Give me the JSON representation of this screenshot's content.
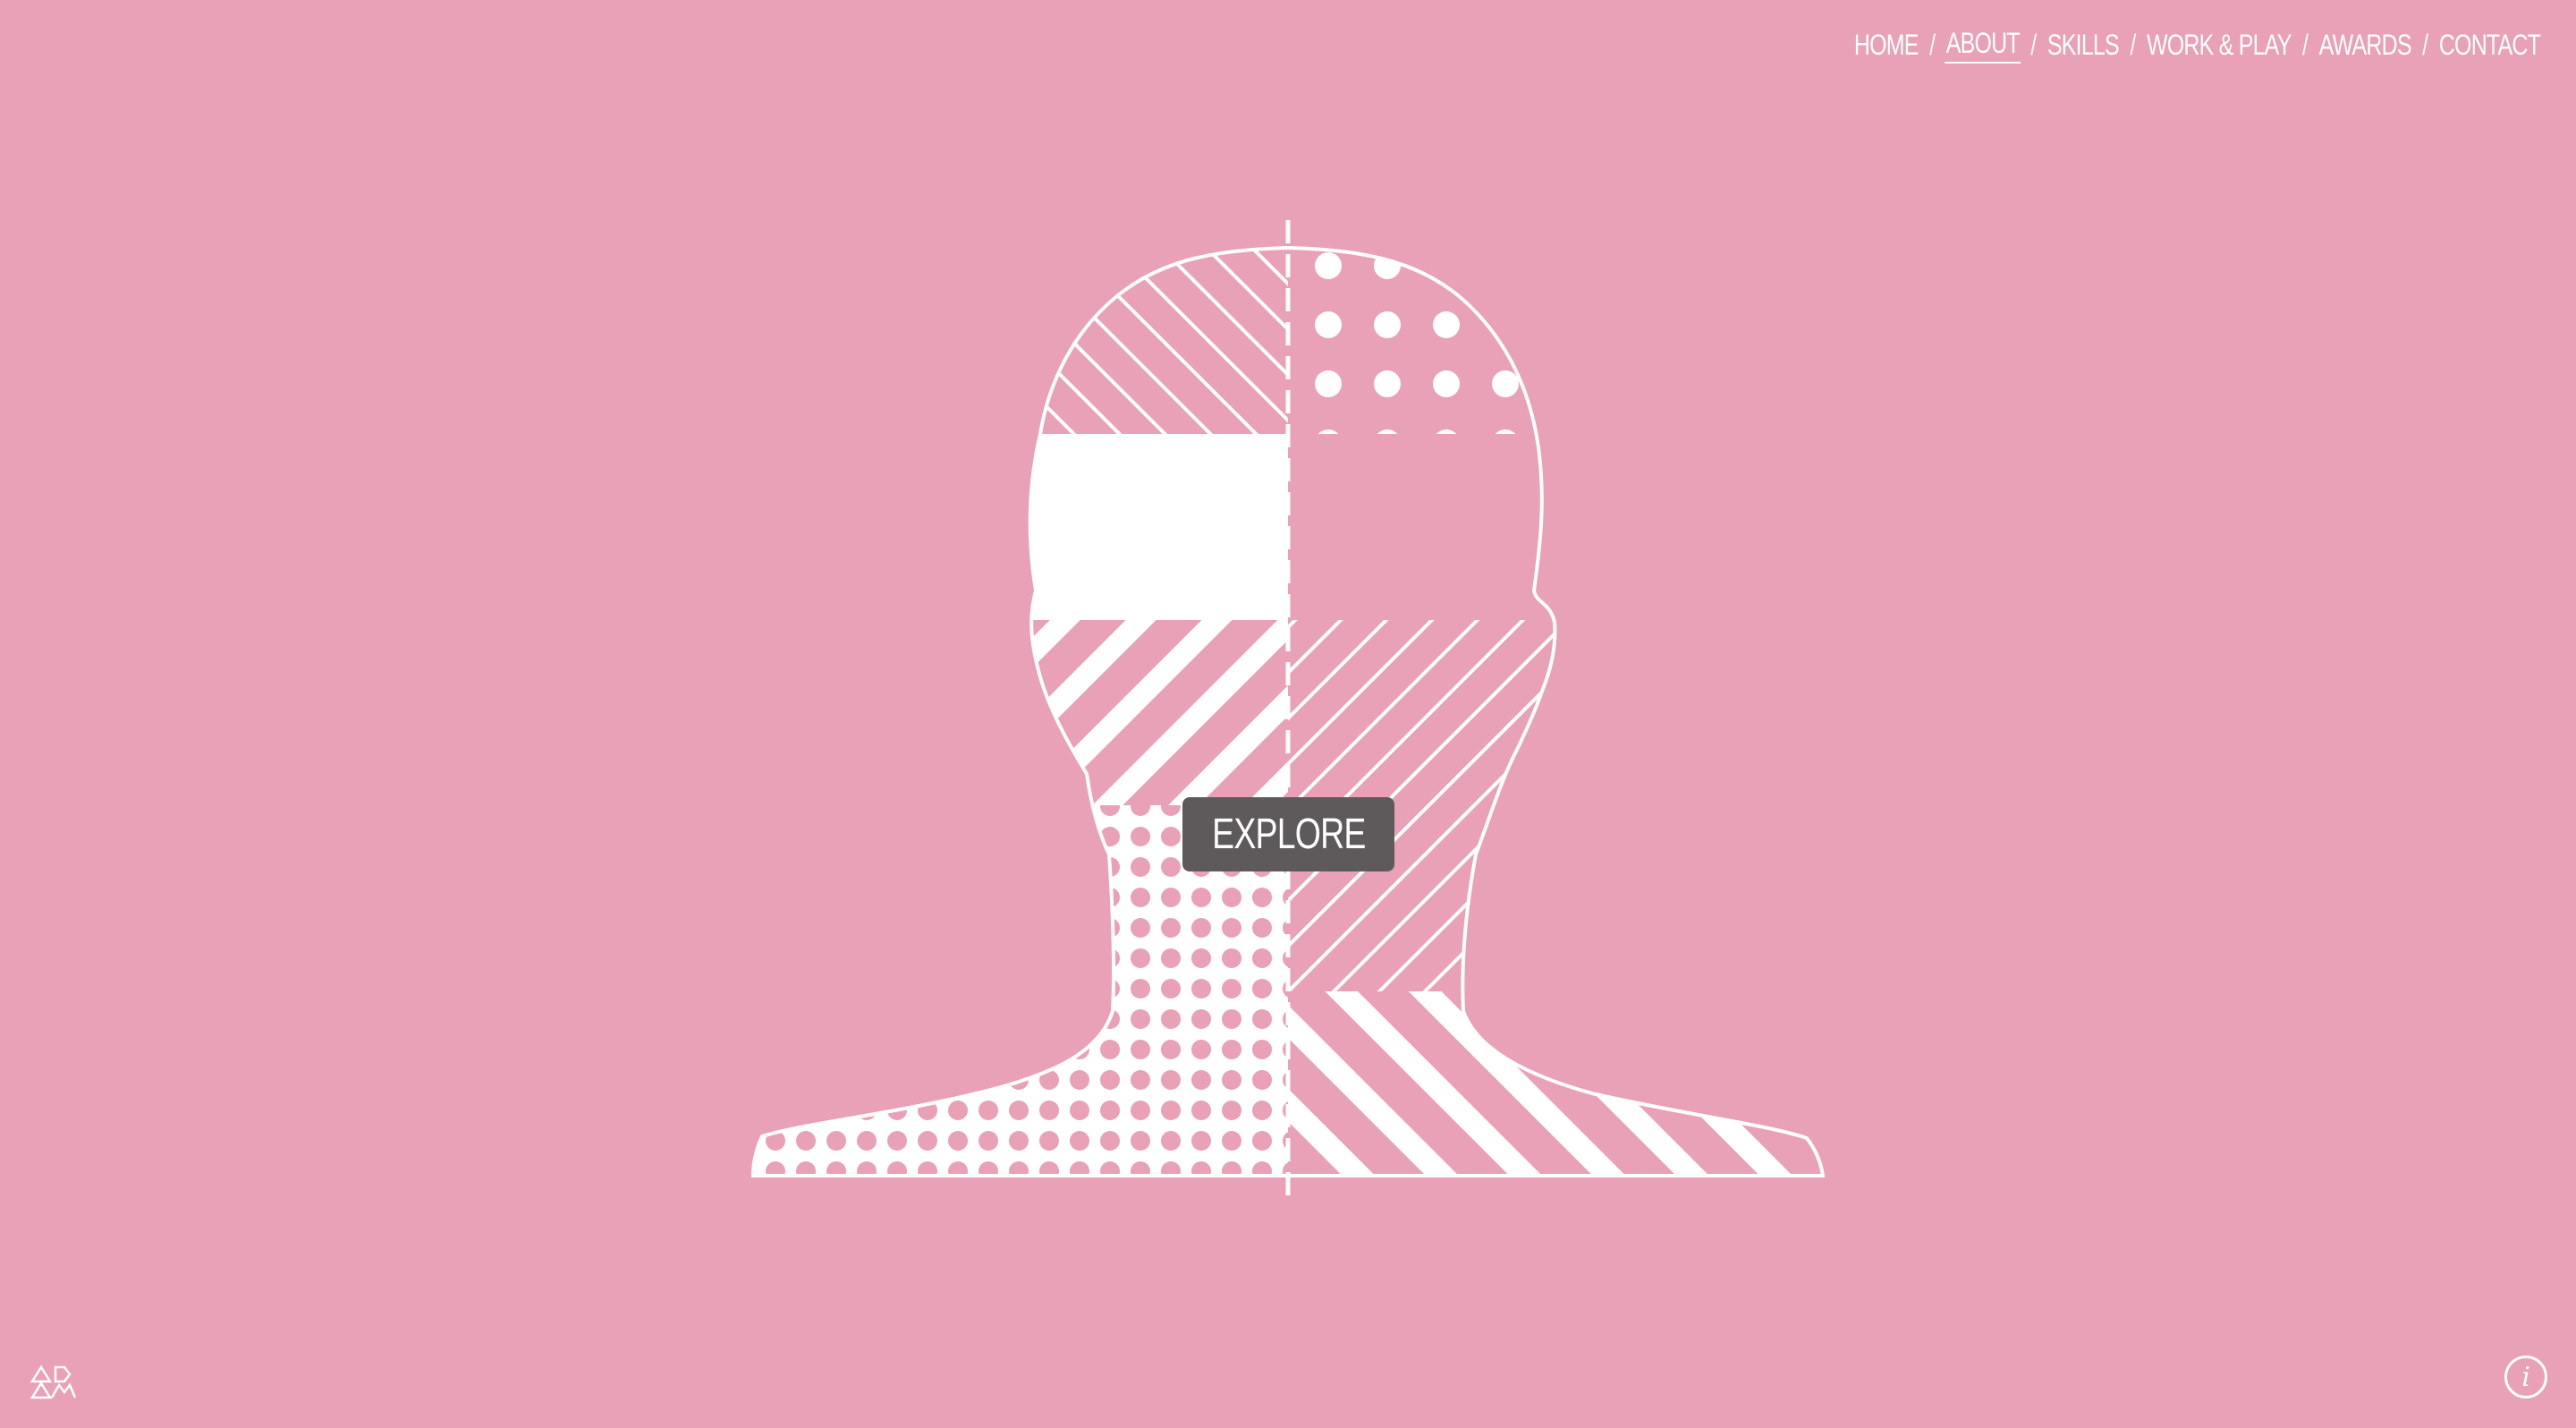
{
  "nav": {
    "items": [
      {
        "label": "Home",
        "active": false
      },
      {
        "label": "About",
        "active": true
      },
      {
        "label": "Skills",
        "active": false
      },
      {
        "label": "Work & Play",
        "active": false
      },
      {
        "label": "Awards",
        "active": false
      },
      {
        "label": "Contact",
        "active": false
      }
    ],
    "separator": "/"
  },
  "hero": {
    "button_label": "Explore",
    "illustration": "patterned-head-silhouette"
  },
  "footer": {
    "logo": "triangle-logo-icon",
    "info_label": "i"
  },
  "colors": {
    "background": "#e8a1b6",
    "foreground": "#ffffff",
    "button": "#5e5a5b"
  }
}
